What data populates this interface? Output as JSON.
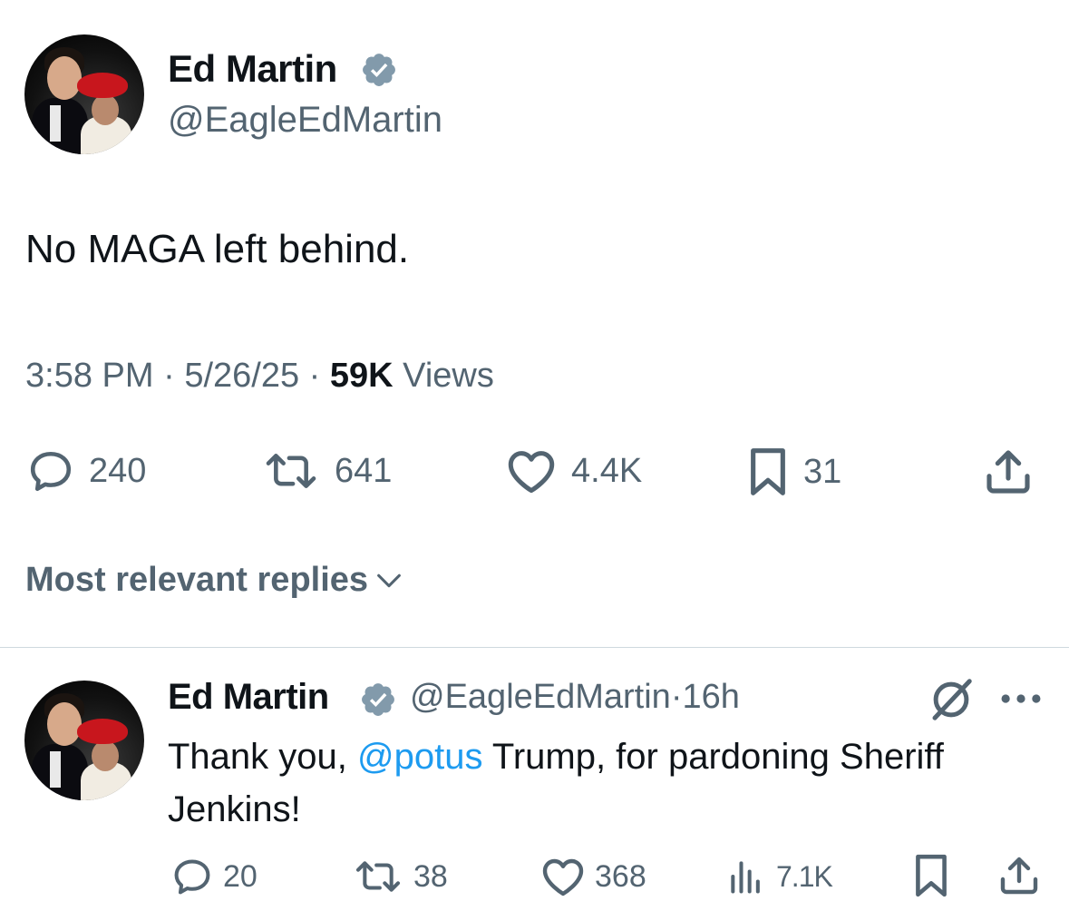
{
  "tweet": {
    "author_name": "Ed Martin",
    "author_handle": "@EagleEdMartin",
    "text": "No MAGA left behind.",
    "time": "3:58 PM",
    "date": "5/26/25",
    "views_count": "59K",
    "views_label": "Views",
    "replies": "240",
    "reposts": "641",
    "likes": "4.4K",
    "bookmarks": "31"
  },
  "replies_filter": {
    "label": "Most relevant replies"
  },
  "reply": {
    "author_name": "Ed Martin",
    "author_handle": "@EagleEdMartin",
    "separator": "·",
    "age": "16h",
    "text_before": "Thank you, ",
    "mention": "@potus",
    "text_after": " Trump, for pardoning Sheriff Jenkins!",
    "replies": "20",
    "reposts": "38",
    "likes": "368",
    "views": "7.1K"
  },
  "colors": {
    "text": "#0f1419",
    "secondary": "#536471",
    "link": "#1d9bf0",
    "divider": "#cfd9de",
    "verified_badge": "#829aab"
  },
  "icons": [
    "verified-badge-icon",
    "reply-icon",
    "repost-icon",
    "like-icon",
    "bookmark-icon",
    "share-icon",
    "views-icon",
    "grok-icon",
    "more-icon",
    "chevron-down-icon"
  ]
}
